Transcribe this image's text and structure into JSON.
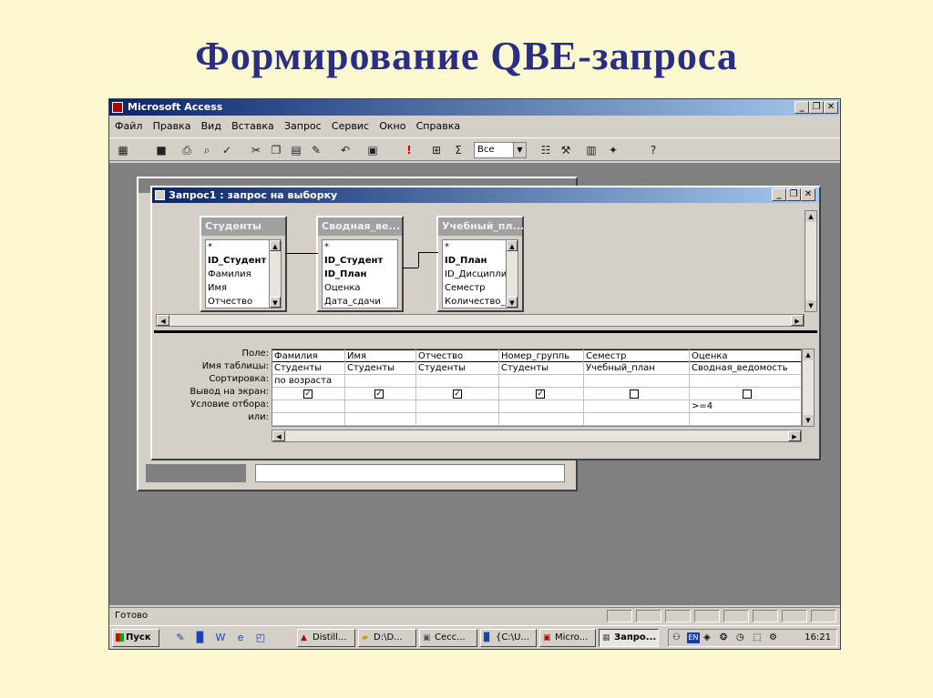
{
  "slide": {
    "title": "Формирование QBE-запроса"
  },
  "app": {
    "title": "Microsoft Access",
    "min_label": "_",
    "restore_label": "❐",
    "close_label": "✕"
  },
  "menu": [
    "Файл",
    "Правка",
    "Вид",
    "Вставка",
    "Запрос",
    "Сервис",
    "Окно",
    "Справка"
  ],
  "toolbar": {
    "combo_value": "Все",
    "combo_arrow": "▼"
  },
  "query_window": {
    "title": "Запрос1 : запрос на выборку",
    "min_label": "_",
    "restore_label": "❐",
    "close_label": "✕"
  },
  "tables": [
    {
      "name": "Студенты",
      "fields": [
        "*",
        "ID_Студент",
        "Фамилия",
        "Имя",
        "Отчество"
      ],
      "bold": [
        1
      ]
    },
    {
      "name": "Сводная_ве...",
      "fields": [
        "*",
        "ID_Студент",
        "ID_План",
        "Оценка",
        "Дата_сдачи"
      ],
      "bold": [
        1,
        2
      ]
    },
    {
      "name": "Учебный_пл...",
      "fields": [
        "*",
        "ID_План",
        "ID_Дисципли",
        "Семестр",
        "Количество_"
      ],
      "bold": [
        1
      ]
    }
  ],
  "grid": {
    "row_labels": [
      "Поле:",
      "Имя таблицы:",
      "Сортировка:",
      "Вывод на экран:",
      "Условие отбора:",
      "или:"
    ],
    "columns": [
      {
        "field": "Фамилия",
        "table": "Студенты",
        "sort": "по возраста",
        "show": true,
        "criteria": ""
      },
      {
        "field": "Имя",
        "table": "Студенты",
        "sort": "",
        "show": true,
        "criteria": ""
      },
      {
        "field": "Отчество",
        "table": "Студенты",
        "sort": "",
        "show": true,
        "criteria": ""
      },
      {
        "field": "Номер_группь",
        "table": "Студенты",
        "sort": "",
        "show": true,
        "criteria": ""
      },
      {
        "field": "Семестр",
        "table": "Учебный_план",
        "sort": "",
        "show": false,
        "criteria": ""
      },
      {
        "field": "Оценка",
        "table": "Сводная_ведомость",
        "sort": "",
        "show": false,
        "criteria": ">=4"
      }
    ]
  },
  "status": {
    "text": "Готово"
  },
  "taskbar": {
    "start_label": "Пуск",
    "tasks": [
      "Distill...",
      "D:\\D...",
      "Сесс...",
      "{C:\\U...",
      "Micro...",
      "Запро..."
    ],
    "tray_lang": "EN",
    "clock": "16:21"
  }
}
